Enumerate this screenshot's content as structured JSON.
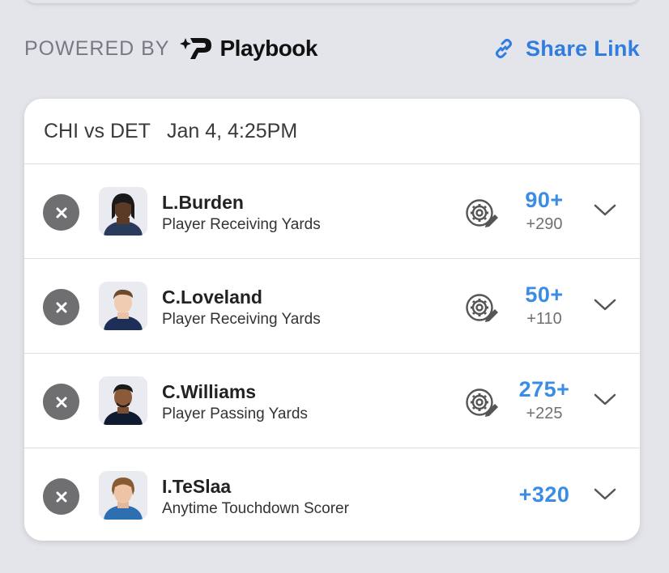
{
  "header": {
    "powered_by": "POWERED BY",
    "brand_name": "Playbook",
    "share_label": "Share Link"
  },
  "game": {
    "matchup": "CHI vs DET",
    "datetime": "Jan 4, 4:25PM"
  },
  "colors": {
    "accent": "#2f7de1",
    "odds_line": "#3b8de3",
    "remove_button": "#6f6f72",
    "background": "#e4e5ea"
  },
  "legs": [
    {
      "player": "L.Burden",
      "market": "Player Receiving Yards",
      "line": "90+",
      "price": "+290",
      "has_edit": true
    },
    {
      "player": "C.Loveland",
      "market": "Player Receiving Yards",
      "line": "50+",
      "price": "+110",
      "has_edit": true
    },
    {
      "player": "C.Williams",
      "market": "Player Passing Yards",
      "line": "275+",
      "price": "+225",
      "has_edit": true
    },
    {
      "player": "I.TeSlaa",
      "market": "Anytime Touchdown Scorer",
      "line": "+320",
      "price": "",
      "has_edit": false
    }
  ],
  "icons": {
    "remove": "close-icon",
    "edit": "gear-edit-icon",
    "expand": "chevron-down-icon",
    "share": "link-icon",
    "brand": "playbook-logo"
  }
}
